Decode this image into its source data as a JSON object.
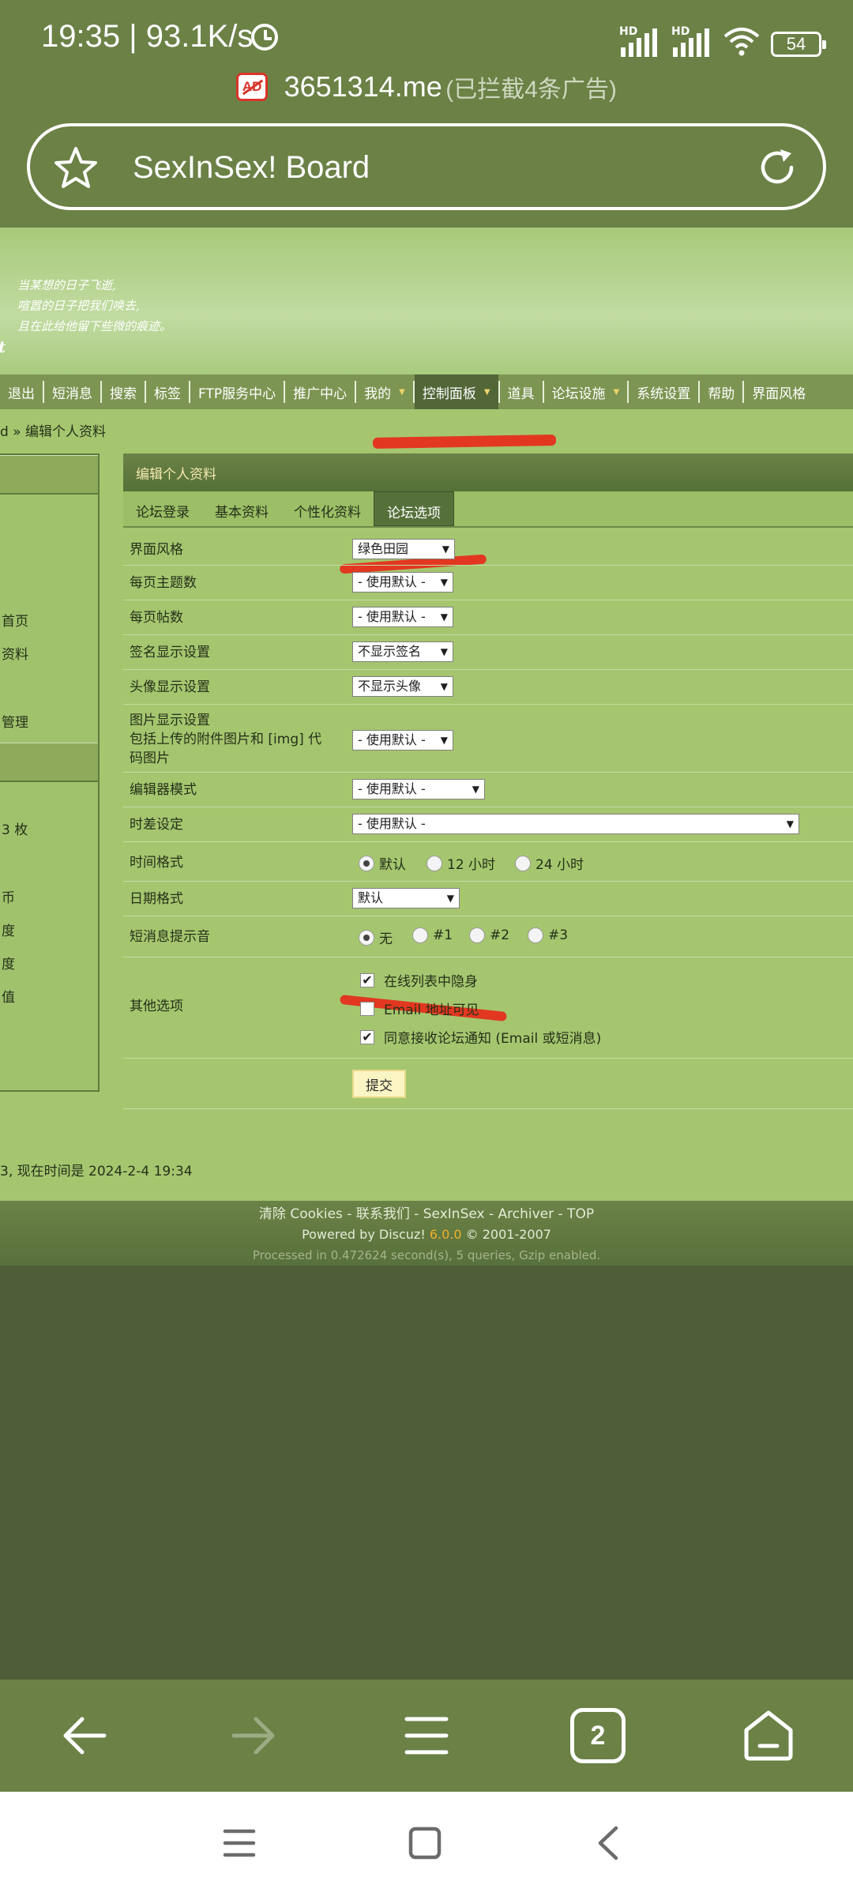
{
  "status_bar": {
    "time": "19:35",
    "speed": "93.1K/s",
    "battery": "54",
    "network_labels": [
      "HD",
      "HD"
    ]
  },
  "browser": {
    "ad_badge": "AD",
    "host": "3651314.me",
    "blocked_note": "(已拦截4条广告)",
    "page_title": "SexInSex! Board",
    "tab_count": "2"
  },
  "banner": {
    "lines": [
      "当某想的日子飞逝,",
      "喧嚣的日子把我们唤去,",
      "且在此给他留下些微的痕迹。"
    ],
    "fragment": "t"
  },
  "menu": {
    "items": [
      {
        "label": "退出"
      },
      {
        "label": "短消息"
      },
      {
        "label": "搜索"
      },
      {
        "label": "标签"
      },
      {
        "label": "FTP服务中心"
      },
      {
        "label": "推广中心"
      },
      {
        "label": "我的"
      },
      {
        "label": "控制面板"
      },
      {
        "label": "道具"
      },
      {
        "label": "论坛设施"
      },
      {
        "label": "系统设置"
      },
      {
        "label": "帮助"
      },
      {
        "label": "界面风格"
      }
    ]
  },
  "breadcrumb": "d » 编辑个人资料",
  "sidebar": {
    "items": [
      "首页",
      "资料",
      "管理",
      "3 枚",
      "币",
      "度",
      "度",
      "值"
    ]
  },
  "panel": {
    "title": "编辑个人资料",
    "tabs": [
      "论坛登录",
      "基本资料",
      "个性化资料",
      "论坛选项"
    ],
    "rows": {
      "style": {
        "label": "界面风格",
        "value": "绿色田园"
      },
      "topics_per_page": {
        "label": "每页主题数",
        "value": "- 使用默认 -"
      },
      "posts_per_page": {
        "label": "每页帖数",
        "value": "- 使用默认 -"
      },
      "signature": {
        "label": "签名显示设置",
        "value": "不显示签名"
      },
      "avatar": {
        "label": "头像显示设置",
        "value": "不显示头像"
      },
      "images": {
        "label_line1": "图片显示设置",
        "label_line2": "包括上传的附件图片和 [img] 代",
        "label_line3": "码图片",
        "value": "- 使用默认 -"
      },
      "editor": {
        "label": "编辑器模式",
        "value": "- 使用默认 -"
      },
      "timezone": {
        "label": "时差设定",
        "value": "- 使用默认 -"
      },
      "time_format": {
        "label": "时间格式",
        "options": [
          "默认",
          "12 小时",
          "24 小时"
        ]
      },
      "date_format": {
        "label": "日期格式",
        "value": "默认"
      },
      "pm_sound": {
        "label": "短消息提示音",
        "options": [
          "无",
          "#1",
          "#2",
          "#3"
        ]
      },
      "other": {
        "label": "其他选项",
        "options": [
          "在线列表中隐身",
          "Email 地址可见",
          "同意接收论坛通知 (Email 或短消息)"
        ]
      }
    },
    "submit": "提交"
  },
  "time_line": "3, 现在时间是 2024-2-4 19:34",
  "footer": {
    "links": "清除 Cookies - 联系我们 - SexInSex - Archiver - TOP",
    "powered_prefix": "Powered by Discuz!",
    "version": "6.0.0",
    "powered_suffix": "© 2001-2007",
    "processed": "Processed in 0.472624 second(s), 5 queries, Gzip enabled."
  },
  "colors": {
    "chrome": "#6b8146",
    "page": "#a5c66f",
    "annotation": "#e23720"
  }
}
